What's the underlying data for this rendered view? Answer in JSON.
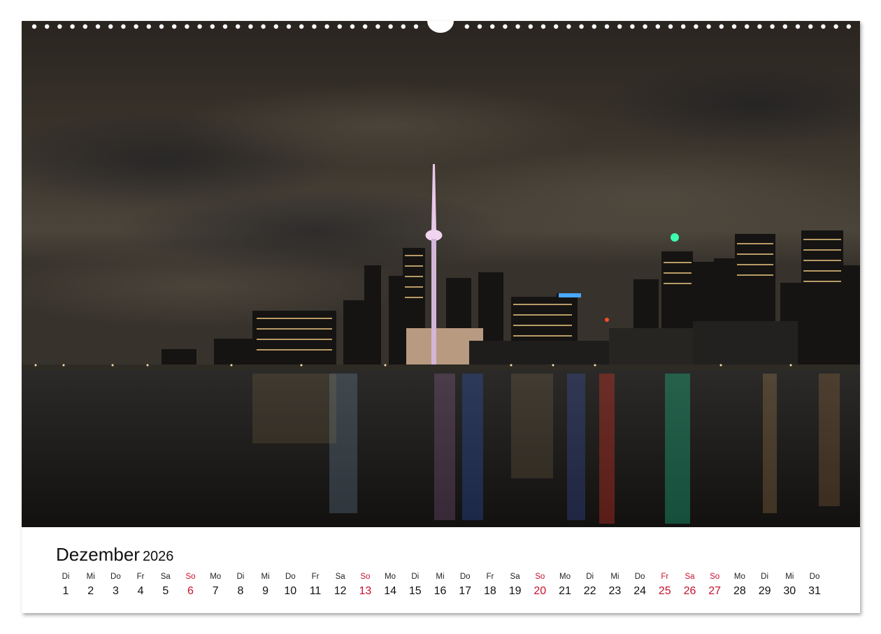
{
  "calendar": {
    "month": "Dezember",
    "year": "2026",
    "days": [
      {
        "wd": "Di",
        "d": "1",
        "red": false
      },
      {
        "wd": "Mi",
        "d": "2",
        "red": false
      },
      {
        "wd": "Do",
        "d": "3",
        "red": false
      },
      {
        "wd": "Fr",
        "d": "4",
        "red": false
      },
      {
        "wd": "Sa",
        "d": "5",
        "red": false
      },
      {
        "wd": "So",
        "d": "6",
        "red": true
      },
      {
        "wd": "Mo",
        "d": "7",
        "red": false
      },
      {
        "wd": "Di",
        "d": "8",
        "red": false
      },
      {
        "wd": "Mi",
        "d": "9",
        "red": false
      },
      {
        "wd": "Do",
        "d": "10",
        "red": false
      },
      {
        "wd": "Fr",
        "d": "11",
        "red": false
      },
      {
        "wd": "Sa",
        "d": "12",
        "red": false
      },
      {
        "wd": "So",
        "d": "13",
        "red": true
      },
      {
        "wd": "Mo",
        "d": "14",
        "red": false
      },
      {
        "wd": "Di",
        "d": "15",
        "red": false
      },
      {
        "wd": "Mi",
        "d": "16",
        "red": false
      },
      {
        "wd": "Do",
        "d": "17",
        "red": false
      },
      {
        "wd": "Fr",
        "d": "18",
        "red": false
      },
      {
        "wd": "Sa",
        "d": "19",
        "red": false
      },
      {
        "wd": "So",
        "d": "20",
        "red": true
      },
      {
        "wd": "Mo",
        "d": "21",
        "red": false
      },
      {
        "wd": "Di",
        "d": "22",
        "red": false
      },
      {
        "wd": "Mi",
        "d": "23",
        "red": false
      },
      {
        "wd": "Do",
        "d": "24",
        "red": false
      },
      {
        "wd": "Fr",
        "d": "25",
        "red": true
      },
      {
        "wd": "Sa",
        "d": "26",
        "red": true
      },
      {
        "wd": "So",
        "d": "27",
        "red": true
      },
      {
        "wd": "Mo",
        "d": "28",
        "red": false
      },
      {
        "wd": "Di",
        "d": "29",
        "red": false
      },
      {
        "wd": "Mi",
        "d": "30",
        "red": false
      },
      {
        "wd": "Do",
        "d": "31",
        "red": false
      }
    ]
  },
  "colors": {
    "holiday": "#c8102e",
    "text": "#111111"
  }
}
